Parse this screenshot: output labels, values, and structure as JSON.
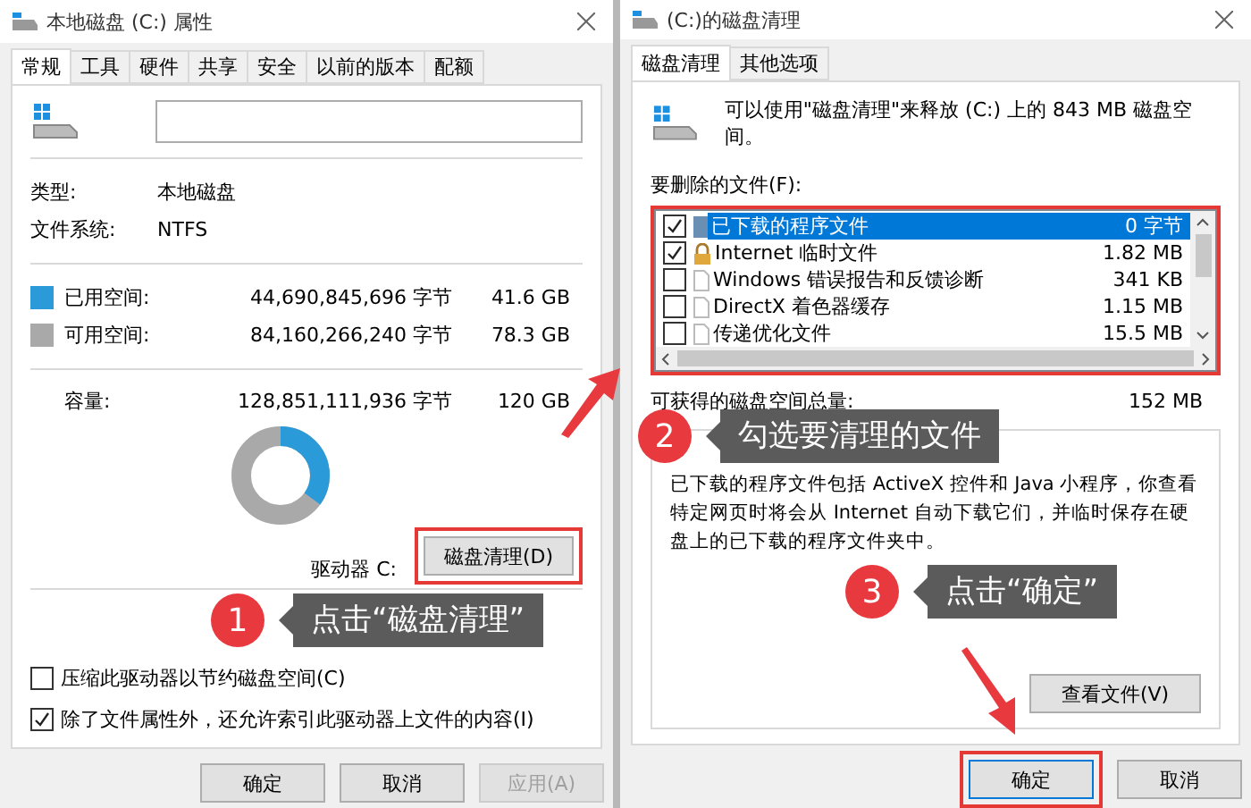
{
  "properties_window": {
    "title": "本地磁盘 (C:) 属性",
    "tabs": [
      {
        "label": "常规",
        "selected": true
      },
      {
        "label": "工具",
        "selected": false
      },
      {
        "label": "硬件",
        "selected": false
      },
      {
        "label": "共享",
        "selected": false
      },
      {
        "label": "安全",
        "selected": false
      },
      {
        "label": "以前的版本",
        "selected": false
      },
      {
        "label": "配额",
        "selected": false
      }
    ],
    "info": [
      {
        "label": "类型:",
        "value": "本地磁盘"
      },
      {
        "label": "文件系统:",
        "value": "NTFS"
      }
    ],
    "space_rows": [
      {
        "label": "已用空间:",
        "bytes": "44,690,845,696 字节",
        "size": "41.6 GB",
        "color": "#2b9ad8"
      },
      {
        "label": "可用空间:",
        "bytes": "84,160,266,240 字节",
        "size": "78.3 GB",
        "color": "#a9a9a9"
      }
    ],
    "capacity": {
      "label": "容量:",
      "bytes": "128,851,111,936 字节",
      "size": "120 GB"
    },
    "usage_chart": {
      "level": 0.35
    },
    "drive_label": "驱动器 C:",
    "cleanup_button": "磁盘清理(D)",
    "checkboxes": [
      {
        "label": "压缩此驱动器以节约磁盘空间(C)",
        "checked": false
      },
      {
        "label": "除了文件属性外，还允许索引此驱动器上文件的内容(I)",
        "checked": true
      }
    ],
    "buttons": [
      {
        "label": "确定",
        "disabled": false
      },
      {
        "label": "取消",
        "disabled": false
      },
      {
        "label": "应用(A)",
        "disabled": true
      }
    ]
  },
  "cleanup_window": {
    "title": "(C:)的磁盘清理",
    "tabs": [
      {
        "label": "磁盘清理",
        "selected": true
      },
      {
        "label": "其他选项",
        "selected": false
      }
    ],
    "summary": "可以使用\"磁盘清理\"来释放  (C:) 上的 843 MB 磁盘空间。",
    "files_label": "要删除的文件(F):",
    "files": [
      {
        "name": "已下载的程序文件",
        "size": "0 字节",
        "checked": true,
        "selected": true,
        "kind": "folder"
      },
      {
        "name": "Internet 临时文件",
        "size": "1.82 MB",
        "checked": true,
        "selected": false,
        "kind": "lock"
      },
      {
        "name": "Windows 错误报告和反馈诊断",
        "size": "341 KB",
        "checked": false,
        "selected": false,
        "kind": "document"
      },
      {
        "name": "DirectX 着色器缓存",
        "size": "1.15 MB",
        "checked": false,
        "selected": false,
        "kind": "document"
      },
      {
        "name": "传递优化文件",
        "size": "15.5 MB",
        "checked": false,
        "selected": false,
        "kind": "document"
      }
    ],
    "total_label": "可获得的磁盘空间总量:",
    "total_value": "152 MB",
    "description": "已下载的程序文件包括 ActiveX 控件和 Java 小程序，你查看特定网页时将会从 Internet 自动下载它们，并临时保存在硬盘上的已下载的程序文件夹中。",
    "view_files_button": "查看文件(V)",
    "buttons": [
      {
        "label": "确定",
        "disabled": false
      },
      {
        "label": "取消",
        "disabled": false
      }
    ]
  },
  "annotations": [
    {
      "number": "1",
      "text": "点击“磁盘清理”"
    },
    {
      "number": "2",
      "text": "勾选要清理的文件"
    },
    {
      "number": "3",
      "text": "点击“确定”"
    }
  ]
}
